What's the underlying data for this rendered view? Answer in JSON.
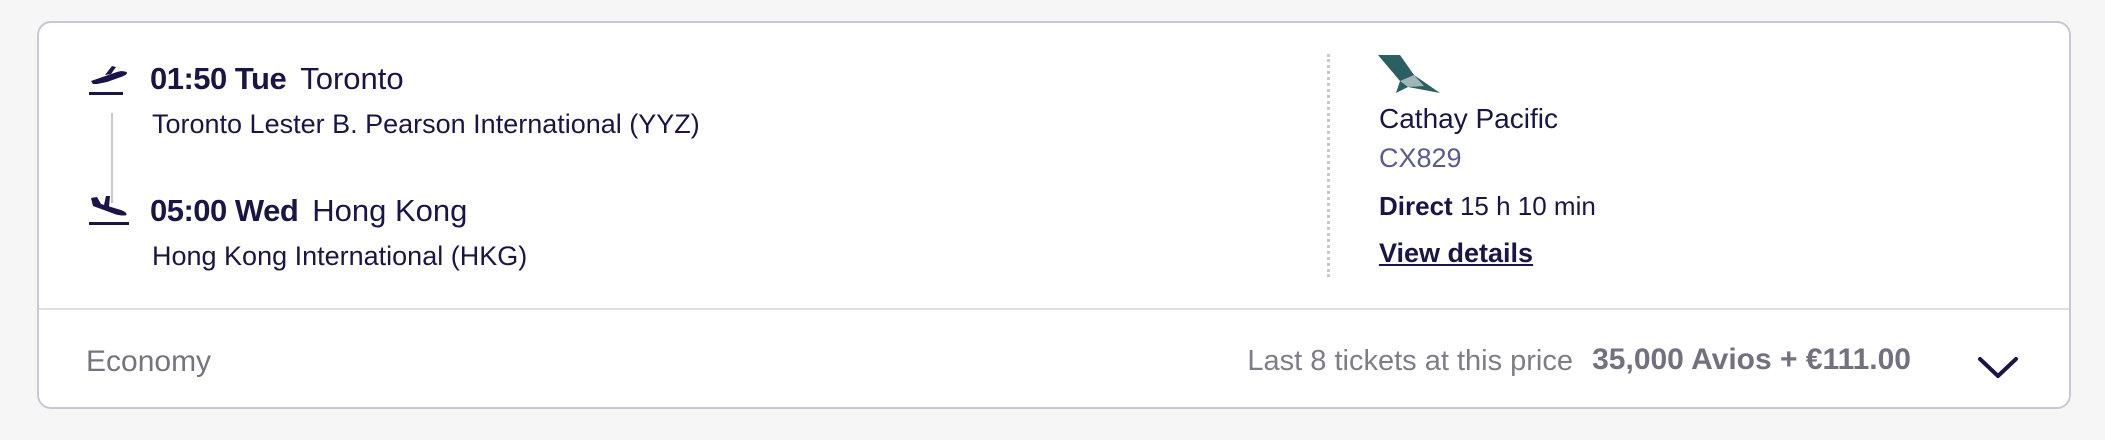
{
  "departure": {
    "time": "01:50 Tue",
    "city": "Toronto",
    "airport": "Toronto Lester B. Pearson International (YYZ)"
  },
  "arrival": {
    "time": "05:00 Wed",
    "city": "Hong Kong",
    "airport": "Hong Kong International (HKG)"
  },
  "airline": {
    "name": "Cathay Pacific",
    "flight_number": "CX829",
    "stops": "Direct",
    "duration": "15 h 10 min",
    "details_link": "View details"
  },
  "footer": {
    "cabin": "Economy",
    "availability": "Last 8 tickets at this price",
    "price": "35,000 Avios + €111.00"
  },
  "icons": {
    "takeoff": "plane-takeoff-icon",
    "landing": "plane-landing-icon",
    "logo": "cathay-pacific-logo",
    "expand": "chevron-down-icon"
  },
  "colors": {
    "text": "#1b1547",
    "logo": "#2b5f62",
    "link": "#1b1547",
    "flight_number": "#5a5a92"
  }
}
